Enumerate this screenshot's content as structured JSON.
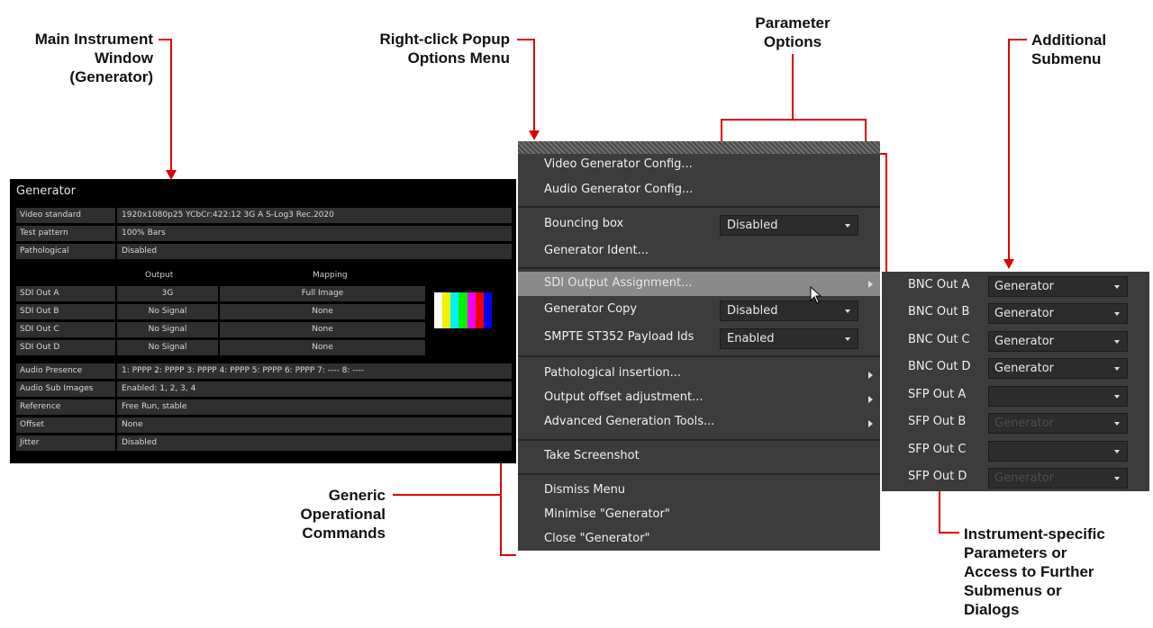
{
  "annotations": {
    "main_window": [
      "Main Instrument",
      "Window",
      "(Generator)"
    ],
    "popup": [
      "Right-click Popup",
      "Options Menu"
    ],
    "param_options": [
      "Parameter",
      "Options"
    ],
    "additional_submenu": [
      "Additional",
      "Submenu"
    ],
    "generic": [
      "Generic",
      "Operational",
      "Commands"
    ],
    "instrument_specific": [
      "Instrument-specific",
      "Parameters or",
      "Access to Further",
      "Submenus or",
      "Dialogs"
    ]
  },
  "generator": {
    "title": "Generator",
    "rows": [
      {
        "label": "Video standard",
        "value": "1920x1080p25 YCbCr:422:12 3G A S-Log3 Rec.2020"
      },
      {
        "label": "Test pattern",
        "value": "100% Bars"
      },
      {
        "label": "Pathological",
        "value": "Disabled"
      }
    ],
    "sdi_headers": {
      "output": "Output",
      "mapping": "Mapping"
    },
    "sdi_rows": [
      {
        "label": "SDI Out A",
        "output": "3G",
        "mapping": "Full Image"
      },
      {
        "label": "SDI Out B",
        "output": "No Signal",
        "mapping": "None"
      },
      {
        "label": "SDI Out C",
        "output": "No Signal",
        "mapping": "None"
      },
      {
        "label": "SDI Out D",
        "output": "No Signal",
        "mapping": "None"
      }
    ],
    "rows2": [
      {
        "label": "Audio Presence",
        "value": "1: PPPP 2: PPPP 3: PPPP 4: PPPP 5: PPPP 6: PPPP 7: ---- 8: ----"
      },
      {
        "label": "Audio Sub Images",
        "value": "Enabled: 1, 2, 3, 4"
      },
      {
        "label": "Reference",
        "value": "Free Run, stable"
      },
      {
        "label": "Offset",
        "value": "None"
      },
      {
        "label": "Jitter",
        "value": "Disabled"
      }
    ],
    "bar_colors": [
      "#ffffff",
      "#f2f200",
      "#00f2f2",
      "#00f200",
      "#f200f2",
      "#f20000",
      "#0000f2"
    ]
  },
  "menu": {
    "items": {
      "video_gen": "Video Generator Config...",
      "audio_gen": "Audio Generator Config...",
      "bouncing": "Bouncing box",
      "bouncing_val": "Disabled",
      "ident": "Generator Ident...",
      "sdi_assign": "SDI Output Assignment...",
      "copy": "Generator Copy",
      "copy_val": "Disabled",
      "smpte": "SMPTE ST352 Payload Ids",
      "smpte_val": "Enabled",
      "patho": "Pathological insertion...",
      "offset": "Output offset adjustment...",
      "advanced": "Advanced Generation Tools...",
      "screenshot": "Take Screenshot",
      "dismiss": "Dismiss Menu",
      "minimise": "Minimise \"Generator\"",
      "close": "Close \"Generator\""
    }
  },
  "submenu": {
    "rows": [
      {
        "label": "BNC Out A",
        "value": "Generator"
      },
      {
        "label": "BNC Out B",
        "value": "Generator"
      },
      {
        "label": "BNC Out C",
        "value": "Generator"
      },
      {
        "label": "BNC Out D",
        "value": "Generator"
      },
      {
        "label": "SFP Out A",
        "value": ""
      },
      {
        "label": "SFP Out B",
        "value": "Generator"
      },
      {
        "label": "SFP Out C",
        "value": ""
      },
      {
        "label": "SFP Out D",
        "value": "Generator"
      }
    ]
  }
}
